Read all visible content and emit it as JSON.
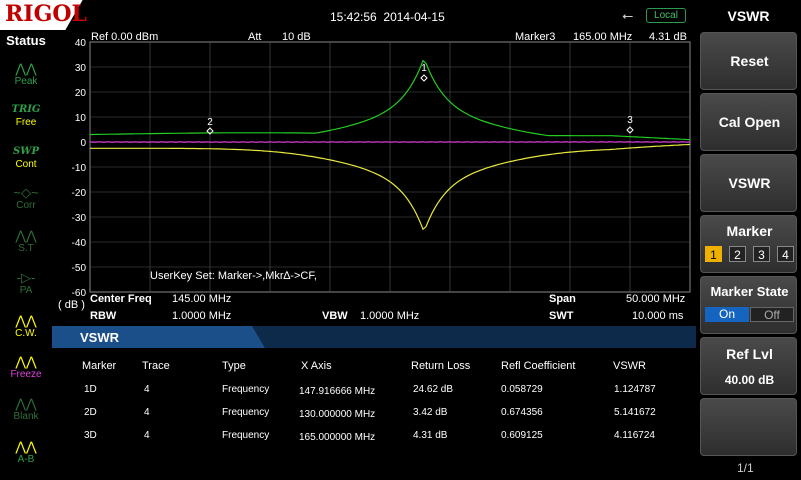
{
  "brand": "RIGOL",
  "header": {
    "time": "15:42:56",
    "date": "2014-04-15",
    "local": "Local"
  },
  "status": {
    "title": "Status",
    "items": [
      {
        "icon": "peak-icon",
        "label": "Peak",
        "color": "#2ea04a"
      },
      {
        "top": "TRIG",
        "label": "Free",
        "color": "#ffff00"
      },
      {
        "top": "SWP",
        "label": "Cont",
        "color": "#ffff00"
      },
      {
        "icon": "corr-icon",
        "label": "Corr",
        "color": "#2e6e3a"
      },
      {
        "icon": "st-icon",
        "label": "S.T",
        "color": "#2e6e3a"
      },
      {
        "icon": "pa-icon",
        "label": "PA",
        "color": "#2e6e3a"
      },
      {
        "icon": "cw-icon",
        "label": "C.W.",
        "color": "#ffff00"
      },
      {
        "icon": "freeze-icon",
        "label": "Freeze",
        "color": "#e040e0"
      },
      {
        "icon": "blank-icon",
        "label": "Blank",
        "color": "#2e6e3a"
      },
      {
        "icon": "amb-icon",
        "label": "A-B",
        "color": "#2ea04a"
      }
    ]
  },
  "plot": {
    "ref": "Ref  0.00 dBm",
    "att_label": "Att",
    "att_value": "10 dB",
    "marker_label": "Marker3",
    "marker_freq": "165.00 MHz",
    "marker_value": "4.31 dB",
    "y_unit": "( dB )",
    "y_ticks": [
      "40",
      "30",
      "20",
      "10",
      "0",
      "-10",
      "-20",
      "-30",
      "-40",
      "-50",
      "-60"
    ],
    "userkey": "UserKey Set:    Marker->,Mkr∆->CF,",
    "markers": [
      "1",
      "2",
      "3"
    ]
  },
  "params": {
    "center_label": "Center Freq",
    "center_value": "145.00 MHz",
    "rbw_label": "RBW",
    "rbw_value": "1.0000 MHz",
    "vbw_label": "VBW",
    "vbw_value": "1.0000 MHz",
    "span_label": "Span",
    "span_value": "50.000 MHz",
    "swt_label": "SWT",
    "swt_value": "10.000 ms"
  },
  "table": {
    "title": "VSWR",
    "headers": [
      "Marker",
      "Trace",
      "Type",
      "X Axis",
      "Return Loss",
      "Refl Coefficient",
      "VSWR"
    ],
    "rows": [
      [
        "1D",
        "4",
        "Frequency",
        "147.916666 MHz",
        "24.62 dB",
        "0.058729",
        "1.124787"
      ],
      [
        "2D",
        "4",
        "Frequency",
        "130.000000 MHz",
        "3.42 dB",
        "0.674356",
        "5.141672"
      ],
      [
        "3D",
        "4",
        "Frequency",
        "165.000000 MHz",
        "4.31 dB",
        "0.609125",
        "4.116724"
      ]
    ]
  },
  "menu": {
    "title": "VSWR",
    "reset": "Reset",
    "cal_open": "Cal Open",
    "vswr": "VSWR",
    "marker": "Marker",
    "marker_options": [
      "1",
      "2",
      "3",
      "4"
    ],
    "marker_state": "Marker State",
    "on": "On",
    "off": "Off",
    "ref_lvl": "Ref Lvl",
    "ref_lvl_value": "40.00 dB",
    "page": "1/1"
  },
  "colors": {
    "trace_green": "#22cc22",
    "trace_yellow": "#e8e840",
    "trace_magenta": "#e040e0",
    "accent_blue": "#1b4f8a",
    "grid": "#555555"
  }
}
